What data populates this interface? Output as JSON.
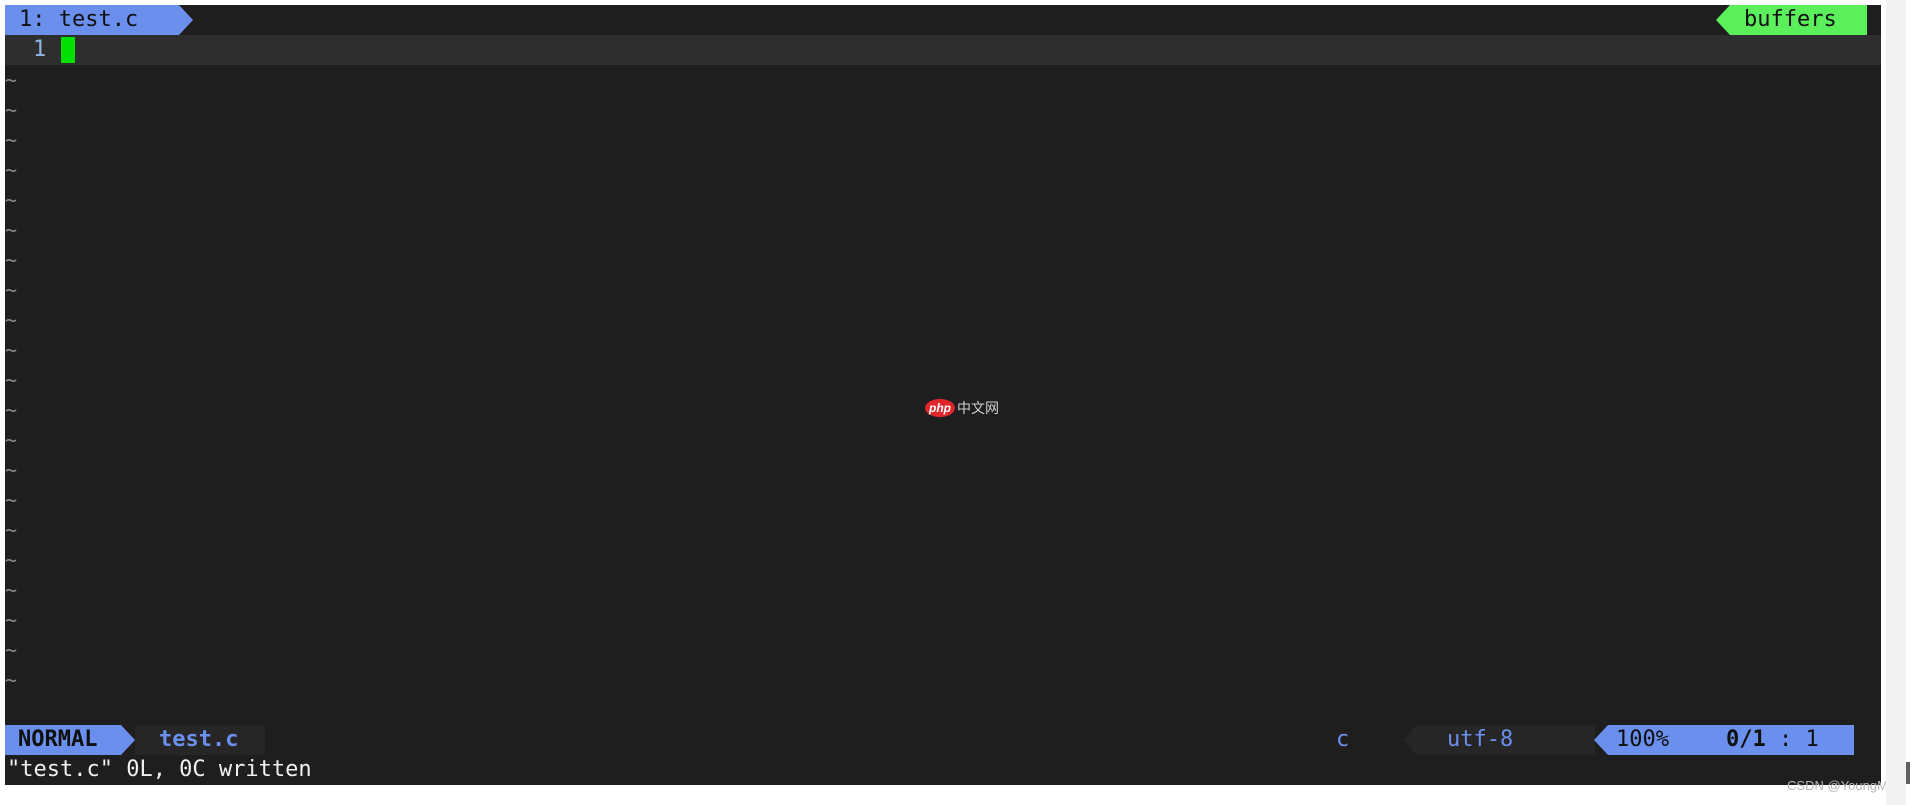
{
  "tabline": {
    "tab_label": "1: test.c",
    "buffers_label": "buffers"
  },
  "editor": {
    "current_line_number": "1",
    "empty_line_marker": "~",
    "empty_line_count": 21
  },
  "statusline": {
    "mode": "NORMAL",
    "filename": "test.c",
    "filetype": "c",
    "encoding": "utf-8",
    "percent": "100%",
    "line_count": "0/1",
    "separator": " : ",
    "column": "1"
  },
  "cmdline": {
    "message": "\"test.c\" 0L, 0C written"
  },
  "watermarks": {
    "center_logo_badge": "php",
    "center_logo_text": "中文网",
    "corner_mark": "CSDN @YoungMLet"
  },
  "colors": {
    "background": "#1e1e1e",
    "accent_blue": "#6a8fec",
    "accent_green": "#5bef5b",
    "cursor": "#00e000"
  }
}
